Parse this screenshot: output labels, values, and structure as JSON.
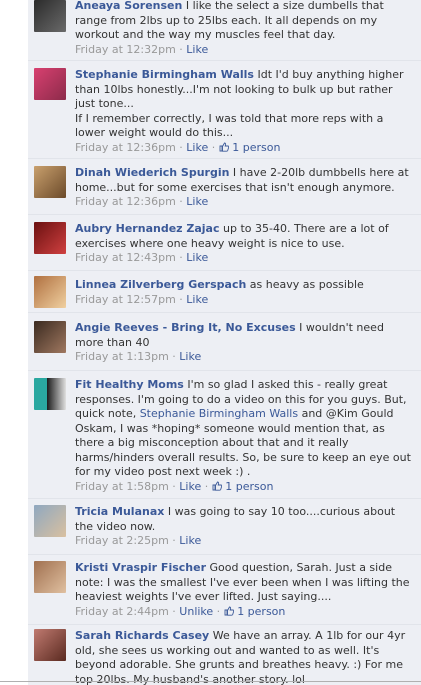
{
  "comments": [
    {
      "name": "Aneaya Sorensen",
      "text": " I like the select a size dumbells that range from 2lbs up to 25lbs each. It all depends on my workout and the way my muscles feel that day.",
      "time": "Friday at 12:32pm",
      "like": "Like",
      "avatar_colors": [
        "#2b2b2b",
        "#5a5a5a"
      ]
    },
    {
      "name": "Stephanie Birmingham Walls",
      "text": " Idt I'd buy anything higher than 10lbs honestly...I'm not looking to bulk up but rather just tone...",
      "text2": "If I remember correctly, I was told that more reps with a lower weight would do this...",
      "time": "Friday at 12:36pm",
      "like": "Like",
      "like_count": "1 person",
      "avatar_colors": [
        "#c2305a",
        "#8c2b4a"
      ]
    },
    {
      "name": "Dinah Wiederich Spurgin",
      "text": " I have 2-20lb dumbbells here at home...but for some exercises that isn't enough anymore.",
      "time": "Friday at 12:36pm",
      "like": "Like",
      "avatar_colors": [
        "#c9a06d",
        "#7b5a3a"
      ]
    },
    {
      "name": "Aubry Hernandez Zajac",
      "text": " up to 35-40. There are a lot of exercises where one heavy weight is nice to use.",
      "time": "Friday at 12:43pm",
      "like": "Like",
      "avatar_colors": [
        "#8a1a1a",
        "#d04040"
      ]
    },
    {
      "name": "Linnea Zilverberg Gerspach",
      "text": " as heavy as possible",
      "time": "Friday at 12:57pm",
      "like": "Like",
      "avatar_colors": [
        "#c98f5f",
        "#e8c49a"
      ]
    },
    {
      "name": "Angie Reeves - Bring It, No Excuses",
      "text": " I wouldn't need more than 40",
      "time": "Friday at 1:13pm",
      "like": "Like",
      "avatar_colors": [
        "#4a3a30",
        "#a07860"
      ]
    },
    {
      "name": "Fit Healthy Moms",
      "text_a": " I'm so glad I asked this - really great responses. I'm going to do a video on this for you guys. But, quick note, ",
      "mention": "Stephanie Birmingham Walls",
      "text_b": " and @Kim Gould Oskam, I was *hoping* someone would mention that, as there a big misconception about that and it really harms/hinders overall results. So, be sure to keep an eye out for my video post next week :) .",
      "time": "Friday at 1:58pm",
      "like": "Like",
      "like_count": "1 person",
      "avatar_colors": [
        "#2aa8a0",
        "#1a1a1a"
      ]
    },
    {
      "name": "Tricia Mulanax",
      "text": " I was going to say 10 too....curious about the video now.",
      "time": "Friday at 2:25pm",
      "like": "Like",
      "avatar_colors": [
        "#8fa8c0",
        "#d9c0a0"
      ]
    },
    {
      "name": "Kristi Vraspir Fischer",
      "text": " Good question, Sarah. Just a side note: I was the smallest I've ever been when I was lifting the heaviest weights I've ever lifted. Just saying....",
      "time": "Friday at 2:44pm",
      "unlike": "Unlike",
      "like_count": "1 person",
      "avatar_colors": [
        "#b08060",
        "#e0c0a0"
      ]
    },
    {
      "name": "Sarah Richards Casey",
      "text": " We have an array. A 1lb for our 4yr old, she sees us working out and wanted to as well. It's beyond adorable. She grunts and breathes heavy. :) For me top 20lbs. My husband's another story. lol",
      "avatar_colors": [
        "#c07a70",
        "#6a3a30"
      ]
    }
  ]
}
